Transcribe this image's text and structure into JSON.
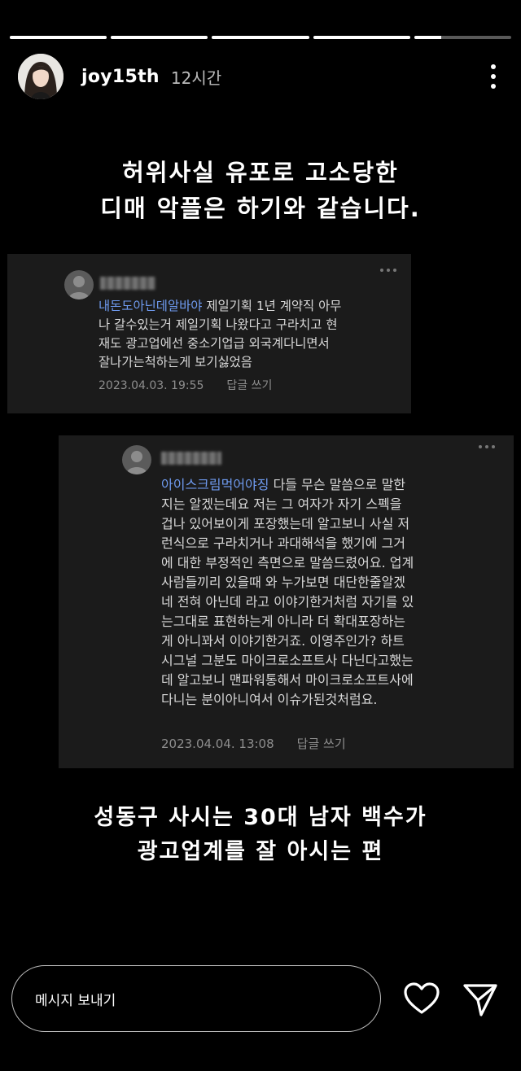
{
  "story": {
    "progress": [
      1,
      1,
      1,
      1,
      0.28
    ]
  },
  "header": {
    "username": "joy15th",
    "time_ago": "12시간",
    "avatar_icon": "profile-photo",
    "more_icon": "more-vertical-icon"
  },
  "headline": {
    "line1": "허위사실 유포로 고소당한",
    "line2": "디매 악플은 하기와 같습니다."
  },
  "comments": [
    {
      "mention": "내돈도아닌데알바야",
      "lines": [
        " 제일기획 1년 계약직 아무",
        "나 갈수있는거 제일기획 나왔다고 구라치고 현",
        "재도 광고업에선 중소기업급 외국계다니면서",
        "잘나가는척하는게 보기싫었음"
      ],
      "date": "2023.04.03. 19:55",
      "reply": "답글 쓰기"
    },
    {
      "mention": "아이스크림먹어야징",
      "lines": [
        " 다들 무슨 말씀으로 말한",
        "지는 알겠는데요 저는 그 여자가 자기 스펙을",
        "겁나 있어보이게 포장했는데 알고보니 사실 저",
        "런식으로 구라치거나 과대해석을 했기에 그거",
        "에 대한 부정적인 측면으로 말씀드렸어요. 업계",
        "사람들끼리 있을때 와 누가보면 대단한줄알겠",
        "네 전혀 아닌데 라고 이야기한거처럼 자기를 있",
        "는그대로 표현하는게 아니라 더 확대포장하는",
        "게 아니꽈서 이야기한거죠. 이영주인가? 하트",
        "시그널 그분도 마이크로소프트사 다닌다고했는",
        "데 알고보니 맨파워통해서 마이크로소프트사에",
        "다니는 분이아니여서 이슈가된것처럼요."
      ],
      "date": "2023.04.04. 13:08",
      "reply": "답글 쓰기"
    }
  ],
  "caption": {
    "line1": "성동구 사시는 30대 남자 백수가",
    "line2": "광고업계를 잘 아시는 편"
  },
  "footer": {
    "message_placeholder": "메시지 보내기",
    "like_icon": "heart-icon",
    "send_icon": "send-icon"
  },
  "colors": {
    "background": "#000000",
    "card": "#1b1b1b",
    "mention": "#6f9bf0"
  }
}
